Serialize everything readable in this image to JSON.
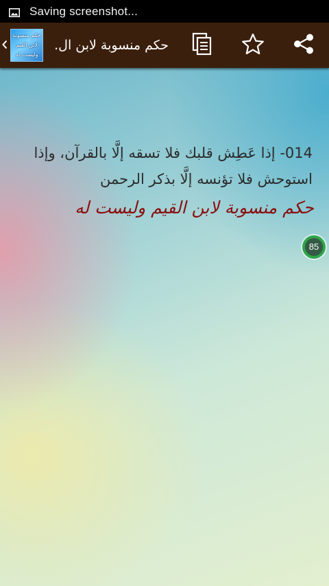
{
  "status_bar": {
    "notification_icon": "image-icon",
    "text": "Saving screenshot..."
  },
  "action_bar": {
    "title": "حكم منسوبة لابن ال.",
    "logo_lines": [
      "حكم منسوبة",
      "لابن القيم",
      "وليست له"
    ],
    "up_icon": "chevron-left-icon",
    "actions": [
      {
        "name": "share",
        "icon": "share-icon"
      },
      {
        "name": "favorite",
        "icon": "star-outline-icon"
      },
      {
        "name": "copy",
        "icon": "copy-icon"
      }
    ],
    "background_color": "#3b1f0d"
  },
  "content": {
    "quote_text": "014- إذا عَطِش قلبك فلا تسقه إلَّا بالقرآن، وإذا استوحش فلا تؤنسه إلَّا بذكر الرحمن",
    "attribution": "حكم منسوبة لابن القيم وليست له",
    "attribution_color": "#8a0f0f",
    "counter": "85"
  }
}
